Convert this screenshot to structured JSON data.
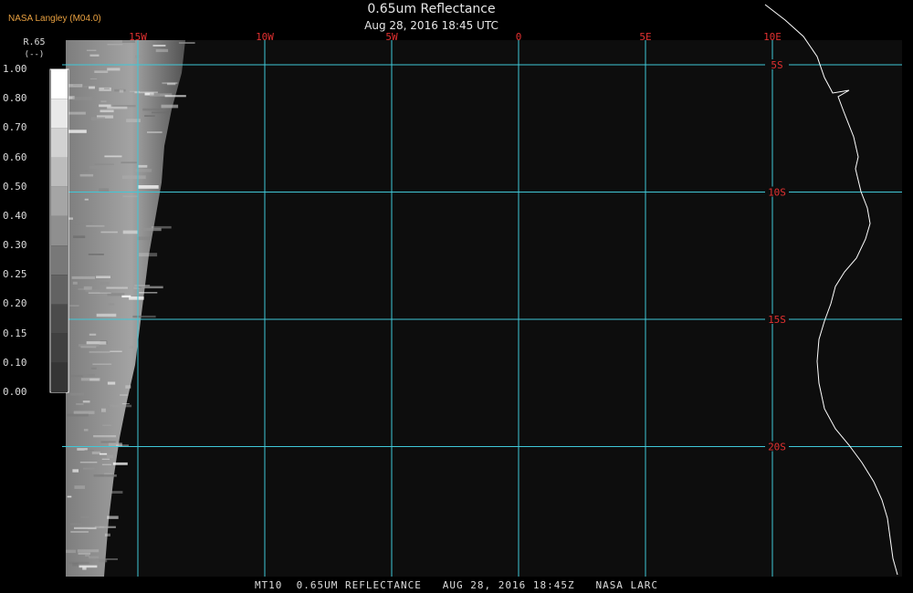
{
  "header": {
    "credit": "NASA Langley (M04.0)",
    "title": "0.65um Reflectance",
    "subtitle": "Aug 28, 2016 18:45 UTC"
  },
  "footer": {
    "caption": "MT10  0.65UM REFLECTANCE   AUG 28, 2016 18:45Z   NASA LARC"
  },
  "legend": {
    "title": "R.65",
    "units": "(--)",
    "units_sub": "(%)",
    "ticks": [
      {
        "label": "1.00",
        "value": 1.0
      },
      {
        "label": "0.80",
        "value": 0.9
      },
      {
        "label": "0.70",
        "value": 0.8
      },
      {
        "label": "0.60",
        "value": 0.7
      },
      {
        "label": "0.50",
        "value": 0.6
      },
      {
        "label": "0.40",
        "value": 0.5
      },
      {
        "label": "0.30",
        "value": 0.4
      },
      {
        "label": "0.25",
        "value": 0.3
      },
      {
        "label": "0.20",
        "value": 0.2
      },
      {
        "label": "0.15",
        "value": 0.15
      },
      {
        "label": "0.10",
        "value": 0.1
      },
      {
        "label": "0.00",
        "value": 0.0
      }
    ]
  },
  "map_data": {
    "lon_lines": [
      {
        "lon": -15,
        "label": "15W"
      },
      {
        "lon": -10,
        "label": "10W"
      },
      {
        "lon": -5,
        "label": "5W"
      },
      {
        "lon": 0,
        "label": "0"
      },
      {
        "lon": 5,
        "label": "5E"
      },
      {
        "lon": 10,
        "label": "10E"
      }
    ],
    "lat_lines": [
      {
        "lat": -5,
        "label": "5S"
      },
      {
        "lat": -10,
        "label": "10S"
      },
      {
        "lat": -15,
        "label": "15S"
      },
      {
        "lat": -20,
        "label": "20S"
      }
    ],
    "colors": {
      "background": "#0d0d0d",
      "grid": "#40c8d8",
      "grid_label": "#e03030",
      "coastline": "#ffffff"
    }
  }
}
